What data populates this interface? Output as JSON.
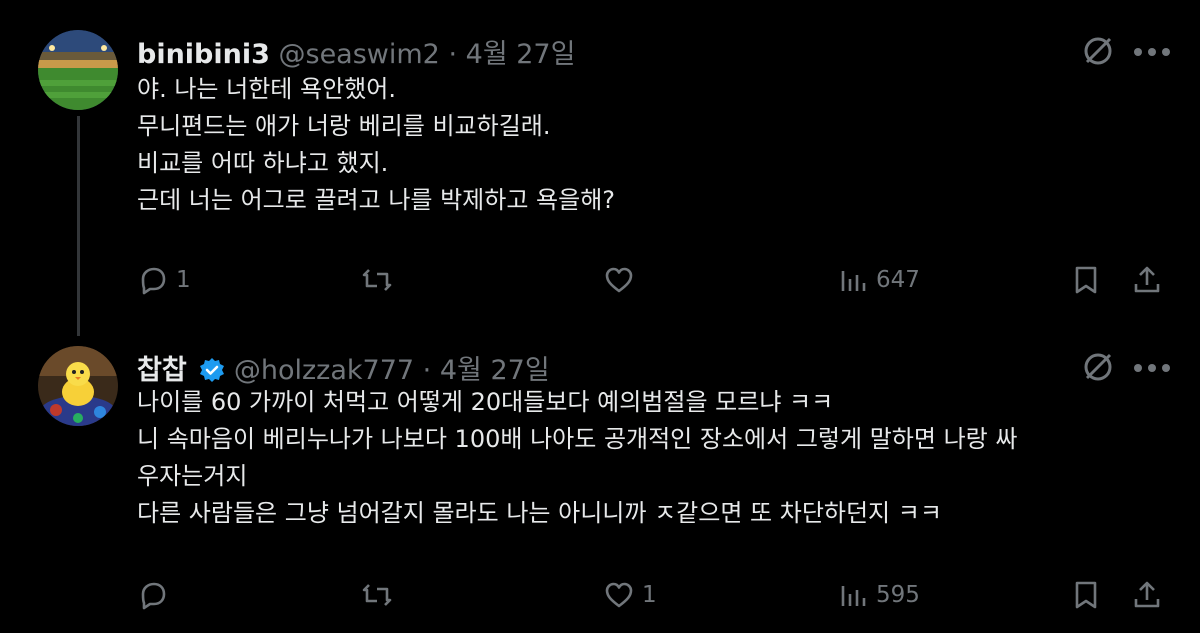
{
  "tweets": [
    {
      "name": "binibini3",
      "handle": "@seaswim2",
      "separator": "·",
      "date": "4월 27일",
      "text": "야. 나는 너한테 욕안했어.\n무니편드는 애가 너랑 베리를 비교하길래.\n비교를 어따 하냐고 했지.\n근데 너는 어그로 끌려고 나를 박제하고 욕을해?",
      "replies": "1",
      "retweets": "",
      "likes": "",
      "views": "647",
      "verified": false
    },
    {
      "name": "찹찹",
      "handle": "@holzzak777",
      "separator": "·",
      "date": "4월 27일",
      "text": "나이를 60 가까이 처먹고 어떻게 20대들보다 예의범절을 모르냐 ㅋㅋ\n니 속마음이 베리누나가 나보다 100배 나아도 공개적인 장소에서 그렇게 말하면 나랑 싸\n우자는거지\n다른 사람들은 그냥 넘어갈지 몰라도 나는 아니니까 ㅈ같으면 또 차단하던지 ㅋㅋ",
      "replies": "",
      "retweets": "",
      "likes": "1",
      "views": "595",
      "verified": true
    }
  ],
  "colors": {
    "background": "#000000",
    "text": "#e7e9ea",
    "muted": "#71767b",
    "verified": "#1d9bf0"
  },
  "icons": [
    "reply-icon",
    "retweet-icon",
    "like-icon",
    "views-icon",
    "bookmark-icon",
    "share-icon",
    "grok-icon",
    "more-icon",
    "verified-badge-icon"
  ]
}
